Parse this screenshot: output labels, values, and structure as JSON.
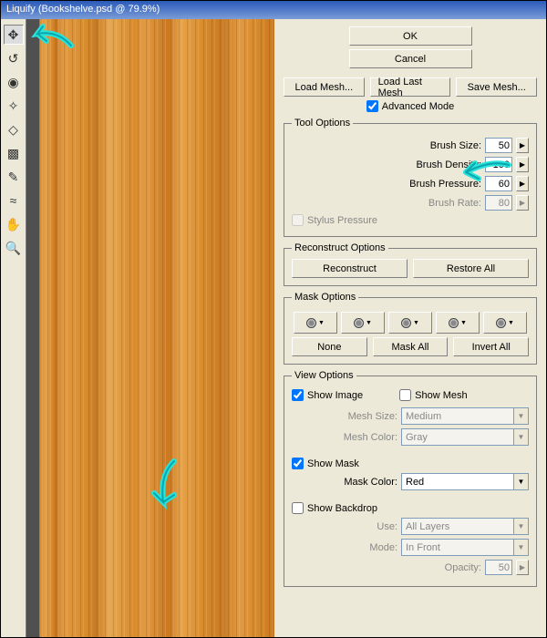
{
  "window": {
    "title": "Liquify (Bookshelve.psd @ 79.9%)"
  },
  "buttons": {
    "ok": "OK",
    "cancel": "Cancel",
    "load_mesh": "Load Mesh...",
    "load_last_mesh": "Load Last Mesh",
    "save_mesh": "Save Mesh...",
    "reconstruct": "Reconstruct",
    "restore_all": "Restore All",
    "none": "None",
    "mask_all": "Mask All",
    "invert_all": "Invert All"
  },
  "advanced_mode": {
    "label": "Advanced Mode",
    "checked": true
  },
  "tool_options": {
    "legend": "Tool Options",
    "brush_size": {
      "label": "Brush Size:",
      "value": "50",
      "enabled": true
    },
    "brush_density": {
      "label": "Brush Density:",
      "value": "100",
      "enabled": true
    },
    "brush_pressure": {
      "label": "Brush Pressure:",
      "value": "60",
      "enabled": true
    },
    "brush_rate": {
      "label": "Brush Rate:",
      "value": "80",
      "enabled": false
    },
    "stylus": {
      "label": "Stylus Pressure",
      "checked": false,
      "enabled": false
    }
  },
  "reconstruct_options": {
    "legend": "Reconstruct Options"
  },
  "mask_options": {
    "legend": "Mask Options"
  },
  "view_options": {
    "legend": "View Options",
    "show_image": {
      "label": "Show Image",
      "checked": true
    },
    "show_mesh": {
      "label": "Show Mesh",
      "checked": false
    },
    "mesh_size": {
      "label": "Mesh Size:",
      "value": "Medium",
      "enabled": false
    },
    "mesh_color": {
      "label": "Mesh Color:",
      "value": "Gray",
      "enabled": false
    },
    "show_mask": {
      "label": "Show Mask",
      "checked": true
    },
    "mask_color": {
      "label": "Mask Color:",
      "value": "Red",
      "enabled": true
    },
    "show_backdrop": {
      "label": "Show Backdrop",
      "checked": false
    },
    "use": {
      "label": "Use:",
      "value": "All Layers",
      "enabled": false
    },
    "mode": {
      "label": "Mode:",
      "value": "In Front",
      "enabled": false
    },
    "opacity": {
      "label": "Opacity:",
      "value": "50",
      "enabled": false
    }
  }
}
